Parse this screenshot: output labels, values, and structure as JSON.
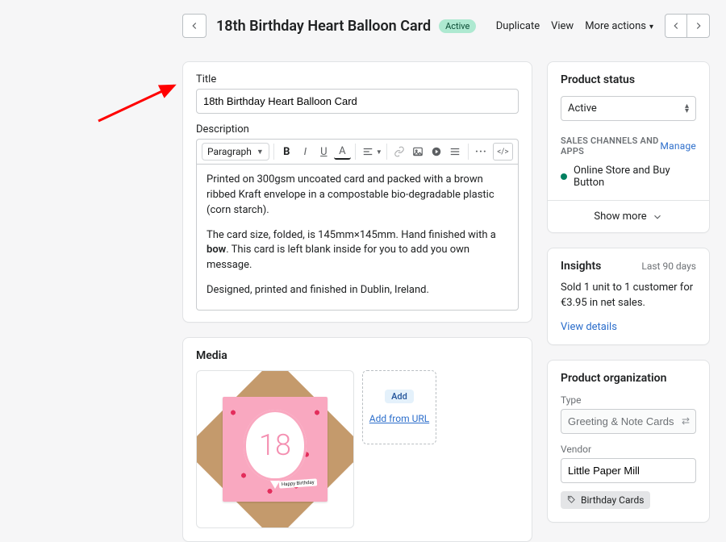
{
  "header": {
    "title": "18th Birthday Heart Balloon Card",
    "status_badge": "Active",
    "actions": {
      "duplicate": "Duplicate",
      "view": "View",
      "more": "More actions"
    }
  },
  "main": {
    "title_label": "Title",
    "title_value": "18th Birthday Heart Balloon Card",
    "description_label": "Description",
    "rte": {
      "paragraph_label": "Paragraph",
      "p1_a": "Printed on 300gsm uncoated card and packed with a brown ribbed Kraft envelope in a compostable bio-degradable plastic (corn starch).",
      "p2_a": "The card size, folded, is 145mm×145mm. Hand finished with a ",
      "p2_bold": "bow",
      "p2_b": ". This card is left blank inside for you to add you own message.",
      "p3": "Designed, printed and finished in Dublin, Ireland."
    },
    "media": {
      "heading": "Media",
      "balloon_number": "18",
      "tag_text": "Happy Birthday",
      "add_label": "Add",
      "add_url_label": "Add from URL"
    }
  },
  "side": {
    "status": {
      "heading": "Product status",
      "value": "Active",
      "channels_label": "SALES CHANNELS AND APPS",
      "manage": "Manage",
      "channel1": "Online Store and Buy Button",
      "show_more": "Show more"
    },
    "insights": {
      "heading": "Insights",
      "range": "Last 90 days",
      "text": "Sold 1 unit to 1 customer for €3.95 in net sales.",
      "view_details": "View details"
    },
    "organization": {
      "heading": "Product organization",
      "type_label": "Type",
      "type_value": "Greeting & Note Cards",
      "vendor_label": "Vendor",
      "vendor_value": "Little Paper Mill",
      "tag1": "Birthday Cards"
    }
  }
}
